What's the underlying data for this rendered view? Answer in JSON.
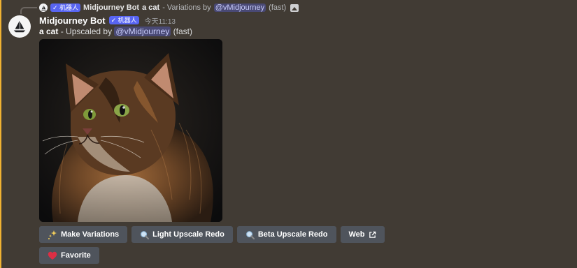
{
  "reply": {
    "bot_badge": "✓ 机器人",
    "author": "Midjourney Bot",
    "prompt": "a cat",
    "text": "- Variations by",
    "mention": "@vMidjourney",
    "speed": "(fast)"
  },
  "message": {
    "author": "Midjourney Bot",
    "bot_badge": "✓ 机器人",
    "timestamp": "今天11:13",
    "prompt": "a cat",
    "text": "- Upscaled by",
    "mention": "@vMidjourney",
    "speed": "(fast)"
  },
  "buttons": {
    "make_variations": "Make Variations",
    "light_upscale_redo": "Light Upscale Redo",
    "beta_upscale_redo": "Beta Upscale Redo",
    "web": "Web",
    "favorite": "Favorite"
  },
  "colors": {
    "background": "#413b34",
    "button": "#4f545c",
    "badge": "#5865f2",
    "accent_bar": "#f0b232"
  },
  "icons": [
    "sparkles-icon",
    "magnifier-icon",
    "external-link-icon",
    "heart-icon",
    "image-icon",
    "sailboat-logo-icon"
  ]
}
